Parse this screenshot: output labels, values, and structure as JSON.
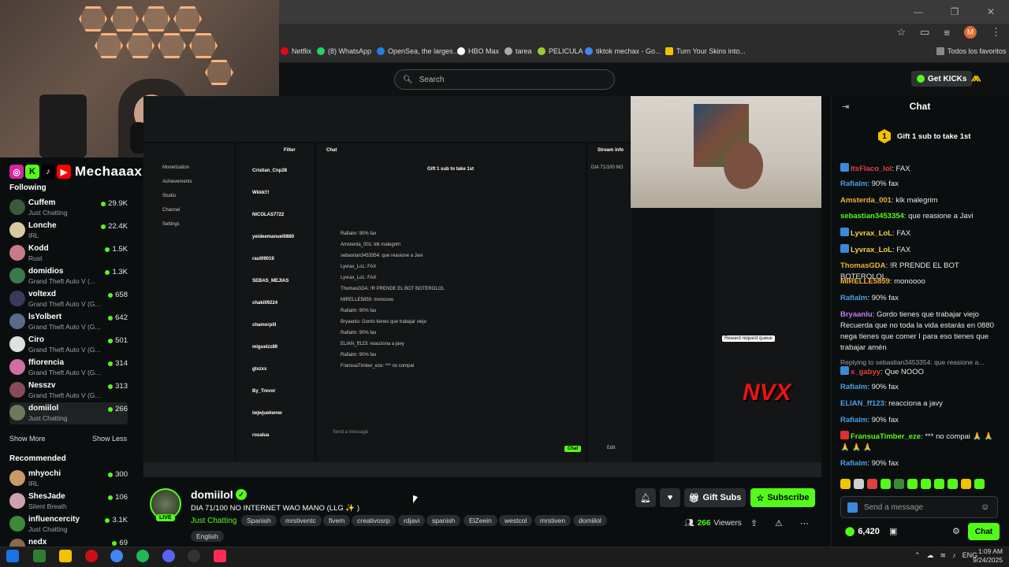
{
  "browser": {
    "bookmarks": [
      "Netflix",
      "(8) WhatsApp",
      "OpenSea, the larges...",
      "HBO Max",
      "tarea",
      "PELICULA",
      "tiktok mechax - Go...",
      "Turn Your Skins into..."
    ],
    "all_bookmarks": "Todos los favoritos",
    "profile_initial": "M"
  },
  "header": {
    "search_placeholder": "Search",
    "get_kicks": "Get KICKs"
  },
  "overlay": {
    "brand": "Mechaaax"
  },
  "sidebar": {
    "following_title": "Following",
    "following": [
      {
        "name": "Cuffem",
        "category": "Just Chatting",
        "viewers": "29.9K",
        "color": "#3b5a3a"
      },
      {
        "name": "Lonche",
        "category": "IRL",
        "viewers": "22.4K",
        "color": "#d8c9a0"
      },
      {
        "name": "Kodd",
        "category": "Rust",
        "viewers": "1.5K",
        "color": "#c77a8a"
      },
      {
        "name": "domidios",
        "category": "Grand Theft Auto V (...",
        "viewers": "1.3K",
        "color": "#3a7a4a"
      },
      {
        "name": "voltexd",
        "category": "Grand Theft Auto V (G...",
        "viewers": "658",
        "color": "#3a3a5a"
      },
      {
        "name": "lsYolbert",
        "category": "Grand Theft Auto V (G...",
        "viewers": "642",
        "color": "#5a6a8a"
      },
      {
        "name": "Ciro",
        "category": "Grand Theft Auto V (G...",
        "viewers": "501",
        "color": "#e0e0e0"
      },
      {
        "name": "ffiorencia",
        "category": "Grand Theft Auto V (G...",
        "viewers": "314",
        "color": "#d070a0"
      },
      {
        "name": "Nesszv",
        "category": "Grand Theft Auto V (G...",
        "viewers": "313",
        "color": "#8a4a5a"
      },
      {
        "name": "domiilol",
        "category": "Just Chatting",
        "viewers": "266",
        "color": "#6b7a5a"
      }
    ],
    "show_more": "Show More",
    "show_less": "Show Less",
    "recommended_title": "Recommended",
    "recommended": [
      {
        "name": "mhyochi",
        "category": "IRL",
        "viewers": "300",
        "color": "#c89a6a"
      },
      {
        "name": "ShesJade",
        "category": "Silent Breath",
        "viewers": "106",
        "color": "#d0a0b0"
      },
      {
        "name": "influencercity",
        "category": "Just Chatting",
        "viewers": "3.1K",
        "color": "#3a8a3a"
      },
      {
        "name": "nedx",
        "category": "",
        "viewers": "69",
        "color": "#8a6a4a"
      }
    ]
  },
  "video": {
    "inner_texts": {
      "filter": "Filter",
      "chat": "Chat",
      "stream_info": "Stream info",
      "gift_line": "Gift 1 sub to take 1st",
      "menu": [
        "Monetization",
        "Achievements",
        "Studio",
        "Channel",
        "Settings"
      ],
      "followers": [
        "Cristian_Cnp28",
        "Wkkk!!!",
        "NICOLAS7722",
        "yeideemanuel0880",
        "raul09019",
        "SEBAS_MEJIAS",
        "chakill9224",
        "chamorpill",
        "miguelzz89",
        "glxzxx",
        "By_Trevor",
        "iwjwjuekwnw",
        "rosalua"
      ],
      "chat_lines": [
        "Rafialm: 90% fax",
        "Amsterda_001: klk malegrim",
        "sebastian3453354: que reasione a Javi",
        "Lyvrax_LoL: FAX",
        "Lyvrax_LoL: FAX",
        "ThomasGDA: !R PRENDE EL BOT BOTEROLOL",
        "MIRELLE5859: monoooo",
        "Rafialm: 90% fax",
        "Bryaanlu: Gordo tienes que trabajar viejo",
        "Rafialm: 90% fax",
        "ELIAN_ff123: reacciona a javy",
        "Rafialm: 90% fax",
        "FransuaTimber_eze: *** no compai"
      ],
      "send_placeholder": "Send a message",
      "chat_btn": "Chat",
      "edit_btn": "Edit",
      "stream_title": "DIA 71/100 NO",
      "reward": "Reward request queue"
    }
  },
  "stream": {
    "name": "domiilol",
    "live": "LIVE",
    "title": "DIA 71/100 NO INTERNET WAO MANO (LLG ✨ )",
    "category": "Just Chatting",
    "tags": [
      "Spanish",
      "mrstiventc",
      "fivem",
      "creativosrp",
      "rdjavi",
      "spanish",
      "ElZeein",
      "westcol",
      "mrstiven",
      "domiilol",
      "English"
    ],
    "gift_subs": "Gift Subs",
    "subscribe": "Subscribe",
    "viewers": "266",
    "viewers_label": "Viewers"
  },
  "chat": {
    "title": "Chat",
    "gift_line": "Gift 1 sub to take 1st",
    "gift_count": "1",
    "messages": [
      {
        "user": "ItsFlaco_lol",
        "text": "FAX",
        "color": "#e04040",
        "badge": "#3a8adc"
      },
      {
        "user": "Rafialm",
        "text": "90% fax",
        "color": "#4aa0e8",
        "badge": ""
      },
      {
        "user": "Amsterda_001",
        "text": "klk malegrim",
        "color": "#f0b03a",
        "badge": ""
      },
      {
        "user": "sebastian3453354",
        "text": "que reasione a Javi",
        "color": "#53fc18",
        "badge": ""
      },
      {
        "user": "Lyvrax_LoL",
        "text": "FAX",
        "color": "#f2d040",
        "badge": "#3a8adc"
      },
      {
        "user": "Lyvrax_LoL",
        "text": "FAX",
        "color": "#f2d040",
        "badge": "#3a8adc"
      },
      {
        "user": "ThomasGDA",
        "text": "!R PRENDE EL BOT BOTEROLOL",
        "color": "#f0b03a",
        "badge": ""
      },
      {
        "user": "MIRELLE5859",
        "text": "monoooo",
        "color": "#f0b03a",
        "badge": ""
      },
      {
        "user": "Rafialm",
        "text": "90% fax",
        "color": "#4aa0e8",
        "badge": ""
      },
      {
        "user": "Bryaanlu",
        "text": "Gordo tienes que trabajar viejo Recuerda que no toda la vida estarás en 0880 nega tienes que comer I para eso tienes que trabajar amén",
        "color": "#c080f0",
        "badge": ""
      }
    ],
    "reply_label": "Replying to sebastian3453354: que reasione a...",
    "messages2": [
      {
        "user": "x_gabyy",
        "text": "Que NOOO",
        "color": "#e04040",
        "badge": "#3a8adc"
      },
      {
        "user": "Rafialm",
        "text": "90% fax",
        "color": "#4aa0e8",
        "badge": ""
      },
      {
        "user": "ELIAN_ff123",
        "text": "reacciona a javy",
        "color": "#4aa0e8",
        "badge": ""
      },
      {
        "user": "Rafialm",
        "text": "90% fax",
        "color": "#4aa0e8",
        "badge": ""
      },
      {
        "user": "FransuaTimber_eze",
        "text": "*** no compai 🙏 🙏 🙏 🙏 🙏",
        "color": "#53fc18",
        "badge": "#e03030"
      },
      {
        "user": "Rafialm",
        "text": "90% fax",
        "color": "#4aa0e8",
        "badge": ""
      }
    ],
    "input_placeholder": "Send a message",
    "points": "6,420",
    "chat_button": "Chat"
  },
  "system": {
    "time": "1:09 AM",
    "date": "9/24/2025",
    "lang": "ENG"
  }
}
